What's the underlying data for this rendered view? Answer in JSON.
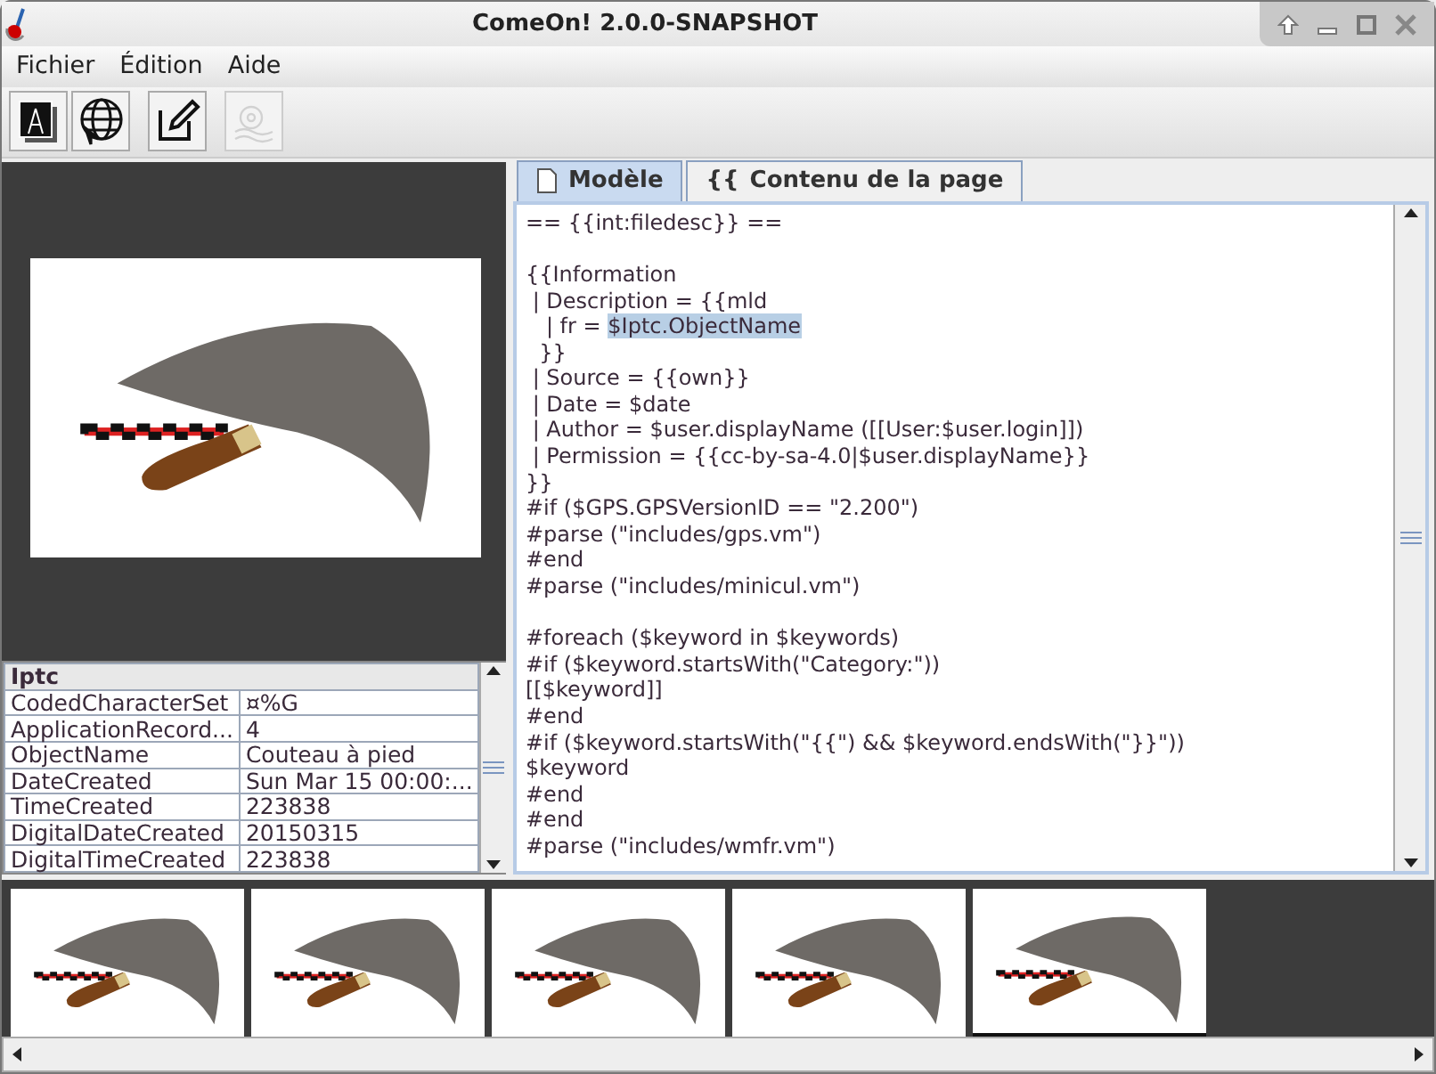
{
  "window": {
    "title": "ComeOn! 2.0.0-SNAPSHOT"
  },
  "menu": [
    {
      "label": "Fichier"
    },
    {
      "label": "Édition"
    },
    {
      "label": "Aide"
    }
  ],
  "toolbar": [
    {
      "kind": "pdf",
      "disabled": false
    },
    {
      "kind": "globe",
      "disabled": false
    },
    {
      "kind": "edit",
      "disabled": false
    },
    {
      "kind": "help",
      "disabled": true
    }
  ],
  "metadata_table": {
    "group": "Iptc",
    "rows": [
      {
        "name": "CodedCharacterSet",
        "value": "¤%G"
      },
      {
        "name": "ApplicationRecord...",
        "value": "4"
      },
      {
        "name": "ObjectName",
        "value": "Couteau à pied"
      },
      {
        "name": "DateCreated",
        "value": "Sun Mar 15 00:00:..."
      },
      {
        "name": "TimeCreated",
        "value": "223838"
      },
      {
        "name": "DigitalDateCreated",
        "value": "20150315"
      },
      {
        "name": "DigitalTimeCreated",
        "value": "223838"
      }
    ]
  },
  "tabs": [
    {
      "label": "Modèle",
      "selected": true
    },
    {
      "label": "Contenu de la page",
      "icon_text": "{{",
      "selected": false
    }
  ],
  "editor": {
    "paragraphs": [
      [
        {
          "text": "== {{int:filedesc}} =="
        }
      ],
      [
        {
          "text": "{{Information"
        },
        {
          "text": " | Description = {{mld"
        },
        {
          "text": "   | fr = ",
          "selection": "$Iptc.ObjectName"
        },
        {
          "text": "  }}"
        },
        {
          "text": " | Source = {{own}}"
        },
        {
          "text": " | Date = $date"
        },
        {
          "text": " | Author = $user.displayName ([[User:$user.login]])"
        },
        {
          "text": " | Permission = {{cc-by-sa-4.0|$user.displayName}}"
        },
        {
          "text": "}}"
        },
        {
          "text": "#if ($GPS.GPSVersionID == \"2.200\")"
        },
        {
          "text": "#parse (\"includes/gps.vm\")"
        },
        {
          "text": "#end"
        },
        {
          "text": "#parse (\"includes/minicul.vm\")"
        }
      ],
      [
        {
          "text": "#foreach ($keyword in $keywords)"
        },
        {
          "text": "#if ($keyword.startsWith(\"Category:\"))"
        },
        {
          "text": "[[$keyword]]"
        },
        {
          "text": "#end"
        },
        {
          "text": "#if ($keyword.startsWith(\"{{\") && $keyword.endsWith(\"}}\"))"
        },
        {
          "text": "$keyword"
        },
        {
          "text": "#end"
        },
        {
          "text": "#end"
        },
        {
          "text": "#parse (\"includes/wmfr.vm\")"
        }
      ]
    ]
  },
  "thumbnails": [
    {
      "selected": false
    },
    {
      "selected": false
    },
    {
      "selected": false
    },
    {
      "selected": false
    },
    {
      "selected": true
    }
  ]
}
